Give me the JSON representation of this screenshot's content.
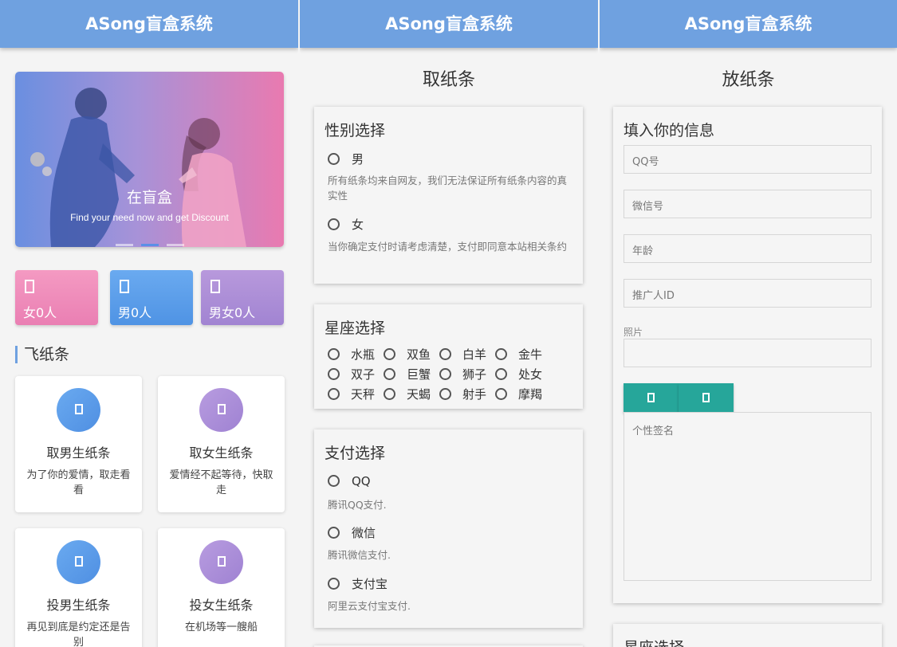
{
  "app_title": "ASong盲盒系统",
  "col1": {
    "banner": {
      "title": "在盲盒",
      "subtitle": "Find your need now and get Discount"
    },
    "stats": [
      {
        "label": "女0人",
        "icon": "female-icon",
        "color": "#ea7fb3"
      },
      {
        "label": "男0人",
        "icon": "male-icon",
        "color": "#4f93e4"
      },
      {
        "label": "男女0人",
        "icon": "couple-icon",
        "color": "#a184d2"
      }
    ],
    "section_title": "飞纸条",
    "cards": [
      {
        "title": "取男生纸条",
        "desc": "为了你的爱情，取走看看",
        "icon": "male-note-icon",
        "color": "blue"
      },
      {
        "title": "取女生纸条",
        "desc": "爱情经不起等待，快取走",
        "icon": "female-note-icon",
        "color": "purple"
      },
      {
        "title": "投男生纸条",
        "desc": "再见到底是约定还是告别",
        "icon": "male-drop-icon",
        "color": "blue"
      },
      {
        "title": "投女生纸条",
        "desc": "在机场等一艘船",
        "icon": "female-drop-icon",
        "color": "purple"
      }
    ]
  },
  "col2": {
    "page_title": "取纸条",
    "gender": {
      "title": "性别选择",
      "options": [
        {
          "label": "男",
          "note": "所有纸条均来自网友，我们无法保证所有纸条内容的真实性"
        },
        {
          "label": "女",
          "note": "当你确定支付时请考虑清楚，支付即同意本站相关条约"
        }
      ]
    },
    "zodiac": {
      "title": "星座选择",
      "signs": [
        "水瓶",
        "双鱼",
        "白羊",
        "金牛",
        "双子",
        "巨蟹",
        "狮子",
        "处女",
        "天秤",
        "天蝎",
        "射手",
        "摩羯"
      ]
    },
    "payment": {
      "title": "支付选择",
      "options": [
        {
          "label": "QQ",
          "note": "腾讯QQ支付."
        },
        {
          "label": "微信",
          "note": "腾讯微信支付."
        },
        {
          "label": "支付宝",
          "note": "阿里云支付宝支付."
        }
      ]
    }
  },
  "col3": {
    "page_title": "放纸条",
    "form": {
      "title": "填入你的信息",
      "qq_placeholder": "QQ号",
      "wechat_placeholder": "微信号",
      "age_placeholder": "年龄",
      "promoter_placeholder": "推广人ID",
      "photo_label": "照片",
      "signature_placeholder": "个性签名"
    },
    "zodiac_title": "星座选择"
  },
  "colors": {
    "header": "#6fa1e0",
    "button": "#26a69a"
  }
}
